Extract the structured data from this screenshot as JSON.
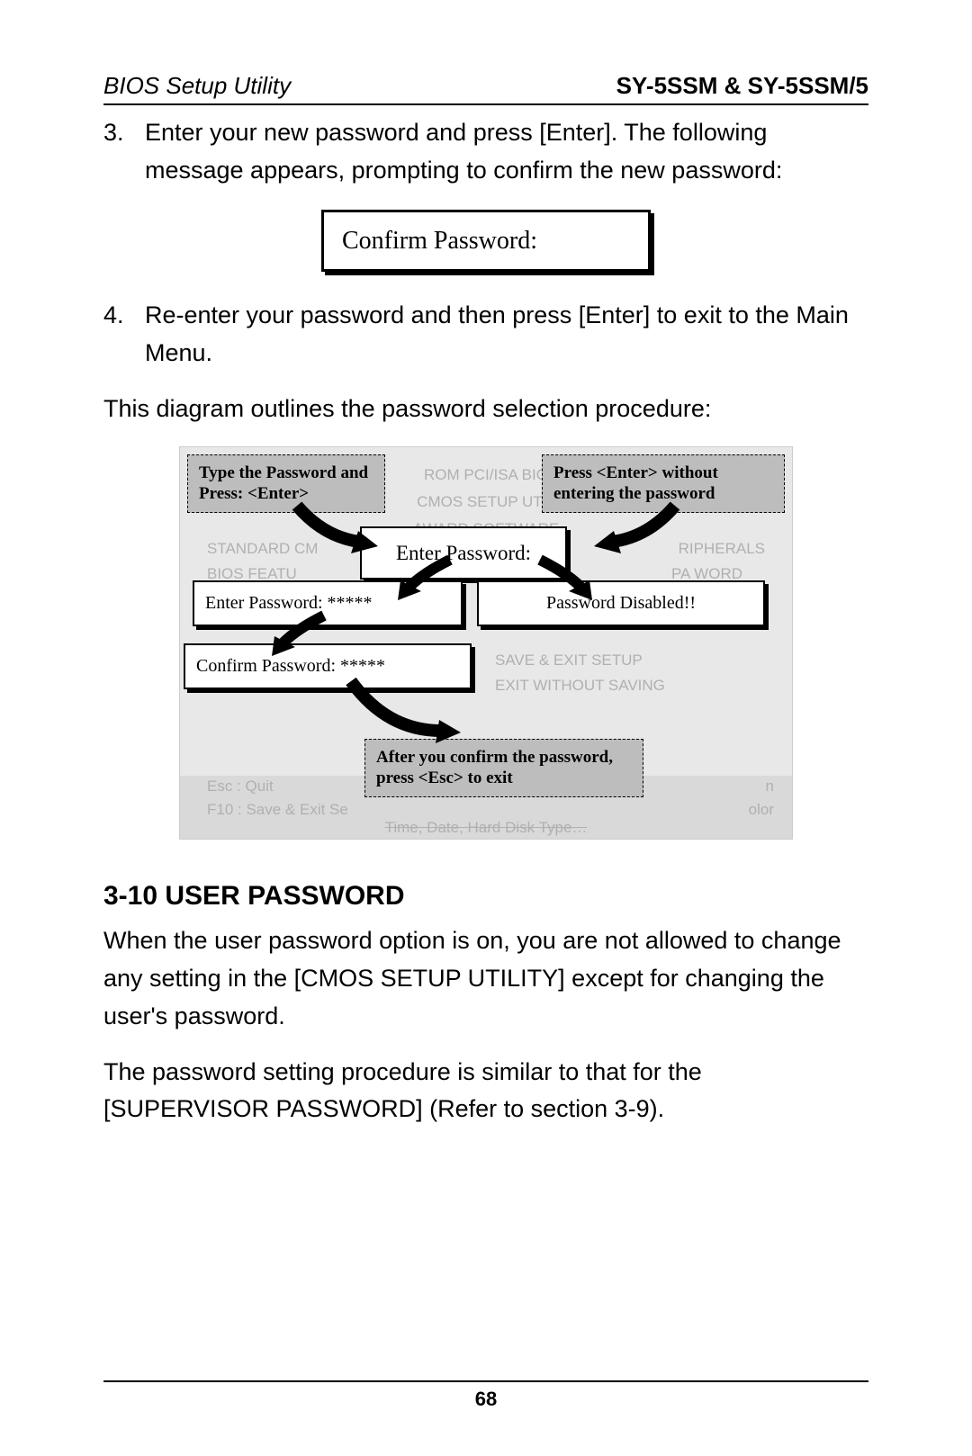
{
  "header": {
    "left": "BIOS Setup Utility",
    "right": "SY-5SSM & SY-5SSM/5"
  },
  "steps": {
    "s3_num": "3.",
    "s3_text": "Enter your new password and press [Enter]. The following message appears, prompting to confirm the new password:",
    "s4_num": "4.",
    "s4_text": "Re-enter your password and then press [Enter] to exit to the Main Menu."
  },
  "confirm_box": "Confirm Password:",
  "intro_diagram": "This diagram outlines the password selection procedure:",
  "diagram": {
    "callout_left": "Type the Password and Press: <Enter>",
    "callout_right": "Press <Enter> without entering the password",
    "callout_bottom": "After you confirm the password, press <Esc> to exit",
    "bios_line1": "ROM PCI/ISA BIO",
    "bios_line2": "CMOS SETUP UTIL",
    "bios_line3": "AWARD SOFTWARE",
    "menu_left1": "STANDARD CM",
    "menu_left2": "BIOS FEATU",
    "menu_right1": "RIPHERALS",
    "menu_right2": "PA      WORD",
    "menu_right3": "SAVE & EXIT SETUP",
    "menu_right4": "EXIT WITHOUT SAVING",
    "footer_left1": "Esc  : Quit",
    "footer_left2": "F10  : Save & Exit Se",
    "footer_right1": "n",
    "footer_right2": "olor",
    "footer_center": "Time, Date, Hard Disk Type…",
    "dlg_enter_top": "Enter Password:",
    "dlg_enter_mask": "Enter Password: *****",
    "dlg_confirm_mask": "Confirm Password: *****",
    "dlg_disabled": "Password Disabled!!"
  },
  "section": {
    "heading": "3-10 USER PASSWORD",
    "p1": "When the user password option is on, you are not allowed to change any setting in the [CMOS SETUP UTILITY] except for changing the user's password.",
    "p2": "The password setting procedure is similar to that for the [SUPERVISOR PASSWORD] (Refer to section 3-9)."
  },
  "page_num": "68"
}
